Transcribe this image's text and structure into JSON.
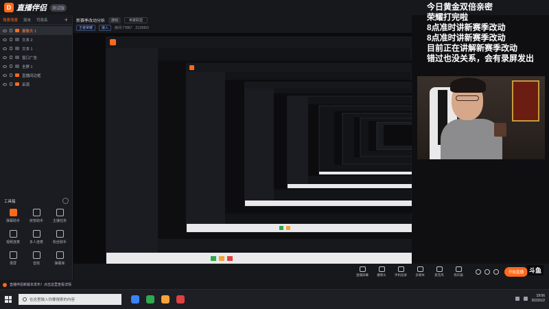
{
  "app": {
    "name": "直播伴侣",
    "version": "测试版"
  },
  "scene_tabs": [
    "场景场景",
    "双击",
    "可改名"
  ],
  "sources": [
    {
      "label": "摄像头 1",
      "highlight": true
    },
    {
      "label": "文本 2",
      "highlight": false
    },
    {
      "label": "文本 1",
      "highlight": false
    },
    {
      "label": "窗口广告",
      "highlight": false
    },
    {
      "label": "全屏 1",
      "highlight": false
    },
    {
      "label": "直播间边框",
      "highlight": false
    },
    {
      "label": "采源",
      "highlight": false
    }
  ],
  "tools": {
    "title": "工具箱",
    "items": [
      {
        "label": "弹幕助手",
        "icon": "danmaku-icon",
        "accent": true
      },
      {
        "label": "房管助手",
        "icon": "admin-icon",
        "accent": false
      },
      {
        "label": "主播任务",
        "icon": "task-icon",
        "accent": false
      },
      {
        "label": "视频连麦",
        "icon": "video-link-icon",
        "accent": false
      },
      {
        "label": "多人连麦",
        "icon": "multi-link-icon",
        "accent": false
      },
      {
        "label": "粉丝助手",
        "icon": "fans-icon",
        "accent": false
      },
      {
        "label": "录屏",
        "icon": "record-icon",
        "accent": false
      },
      {
        "label": "音效",
        "icon": "sound-icon",
        "accent": false
      },
      {
        "label": "弹幕库",
        "icon": "library-icon",
        "accent": false
      }
    ]
  },
  "center": {
    "title": "新赛季改动分析",
    "chip": "游戏",
    "select": "英雄联盟",
    "badge": "王者荣耀",
    "badge2": "接入",
    "room": "房间 77867",
    "viewers": "2129953"
  },
  "bottom_actions": [
    {
      "label": "直播屏幕",
      "icon": "screen-icon"
    },
    {
      "label": "摄像头",
      "icon": "camera-icon"
    },
    {
      "label": "手机投屏",
      "icon": "phone-cast-icon"
    },
    {
      "label": "多媒体",
      "icon": "media-icon"
    },
    {
      "label": "麦克风",
      "icon": "mic-icon"
    },
    {
      "label": "扬声器",
      "icon": "speaker-icon"
    }
  ],
  "go_live": "开始直播",
  "overlay_lines": [
    "今日黄金双倍亲密",
    "荣耀打完啦",
    "8点准时讲新赛季改动",
    "8点准时讲新赛季改动",
    "目前正在讲解新赛季改动",
    "错过也没关系，会有录屏发出"
  ],
  "notice": "直播伴侣新版本发布！点击这里查看详情",
  "taskbar": {
    "search_placeholder": "在这里输入你要搜索的内容",
    "time": "19:56",
    "date": "2023/1/2",
    "brand": "斗鱼"
  }
}
